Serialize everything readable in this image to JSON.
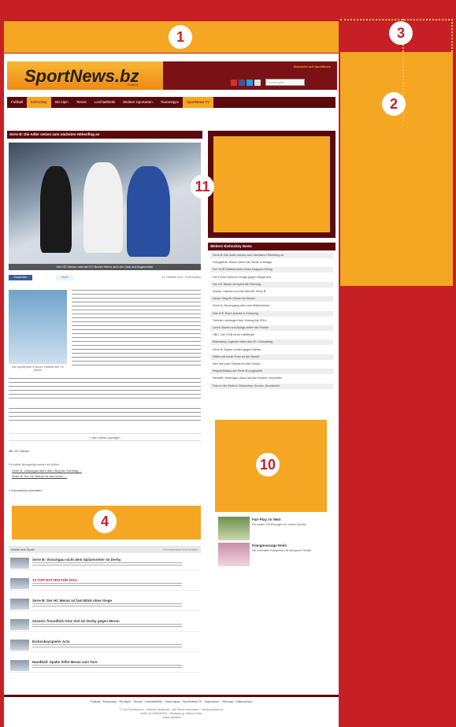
{
  "markers": {
    "m1": "1",
    "m2": "2",
    "m3": "3",
    "m4": "4",
    "m10": "10",
    "m11": "11"
  },
  "header": {
    "logo": "SportNews.bz",
    "logo_sub": "Südtirol",
    "top_link": "Startseite auf SportNews",
    "search_placeholder": "Suchbegriff..."
  },
  "nav": [
    "Fußball",
    "Eishockey",
    "Ski Alpin",
    "Tennis",
    "Leichtathletik",
    "Weitere Sportarten",
    "Tourentipps",
    "SportNews TV"
  ],
  "nav_active_index": 1,
  "article": {
    "bar_title": "Serie B: Die Adler setzen zum nächsten Höhenflug an",
    "photo_caption": "Der HC Meran und der EV Bozen feiern sich als Gast auf Augenhöhe",
    "fb_label": "Empfehlen",
    "tw_label": "Tweet",
    "date": "31. Oktober 2014 · Ill Eishockey",
    "small_caption": "Das Spielerjubel in Bozen erwartet den HC Meran",
    "more_link": "» Alle Artikel anzeigen",
    "author": "Mit: HC Meran",
    "related_heading": "Für Artikel hinzugefügt werden auf Artikel:",
    "related_1": "Serie B: Vinschgau steht dem Sieg am Sonntag ...",
    "related_2": "Serie B: Der HC Meran ist fast sicher ...",
    "comments_link": "» Kommentar schreiben"
  },
  "related": {
    "heading": "Artikel aus Sport",
    "right": "Kommentare zum Artikel",
    "items": [
      "Serie B: Vinschgau nicht dem Spitzenreiter im Derby",
      "13 TOP-RATTEN FÜR 2014",
      "Serie B: Der HC Meran ist fast Blick ohne Siege",
      "Zuzonic freundlich trotz Viel sie Derby gegen Meran",
      "Eishockeyspieler Acts",
      "Handball: Spalte hilfst Meran zum Tore"
    ]
  },
  "sidebar": {
    "ticker_title": "Weitere Eishockey News",
    "ticker": [
      "Serie B: Die Adler setzen zum nächsten Höhenflug an",
      "Fotogalerie: Bozen dreht die Partie in Asiago",
      "Der HCB Südtirol feiert einen knappen Erfolg",
      "Die Foxes verlieren knapp gegen Klagenfurt",
      "Der HC Meran verspielt die Führung",
      "Eppan, Hannes und die Wende: Serie B",
      "Neuer Sieg für Meran bei Bozen",
      "Serie A: Neuzugang wird zum Matchwinner",
      "Das ICE-Team kommt in Schwung",
      "Torhüter verlängert den Vertrag bis 2016",
      "Leoni: Bozen und Asiago teilen die Punkte",
      "HBC: Der HCB ist im Halbfinale",
      "Eishockey-Legende feiert den 60. Geburtstag",
      "Serie B: Eppan verliert gegen Meran",
      "Ritten mit neuer Frau an der Bande",
      "Wer hat noch Tickets für das Derby?",
      "Playoff-Modus der Serie B vorgestellt",
      "Neustift: Vinschgau muss auf den Keeper verzichten",
      "Foto in der Serie A: Eishockey, Kurven, Emotionen"
    ],
    "news": [
      {
        "title": "Fair-Play im Wett",
        "text": "Die ersten 100 Ehrungen für unsere Sportler"
      },
      {
        "title": "Klangmassage Heim",
        "text": "Die schönsten Klangreisen für die ganze Familie"
      }
    ]
  },
  "footer": {
    "nav": "Fußball · Eishockey · Ski Alpin · Tennis · Leichtathletik · Tourentipps · SportNews TV · Impressum · Sitemap · Datenschutz",
    "copy1": "© 2014 SportNews.bz – Südtirols Sportportal – Alle Rechte vorbehalten – info@sportnews.bz",
    "copy2": "MwSt.-Nr. 02810890211 – Realisierung: Südtirol Online",
    "copy3": "Cookie-Richtlinie"
  },
  "colors": {
    "brand_red": "#c62026",
    "ad_orange": "#f5a623",
    "dark_red": "#5a0a0d"
  }
}
